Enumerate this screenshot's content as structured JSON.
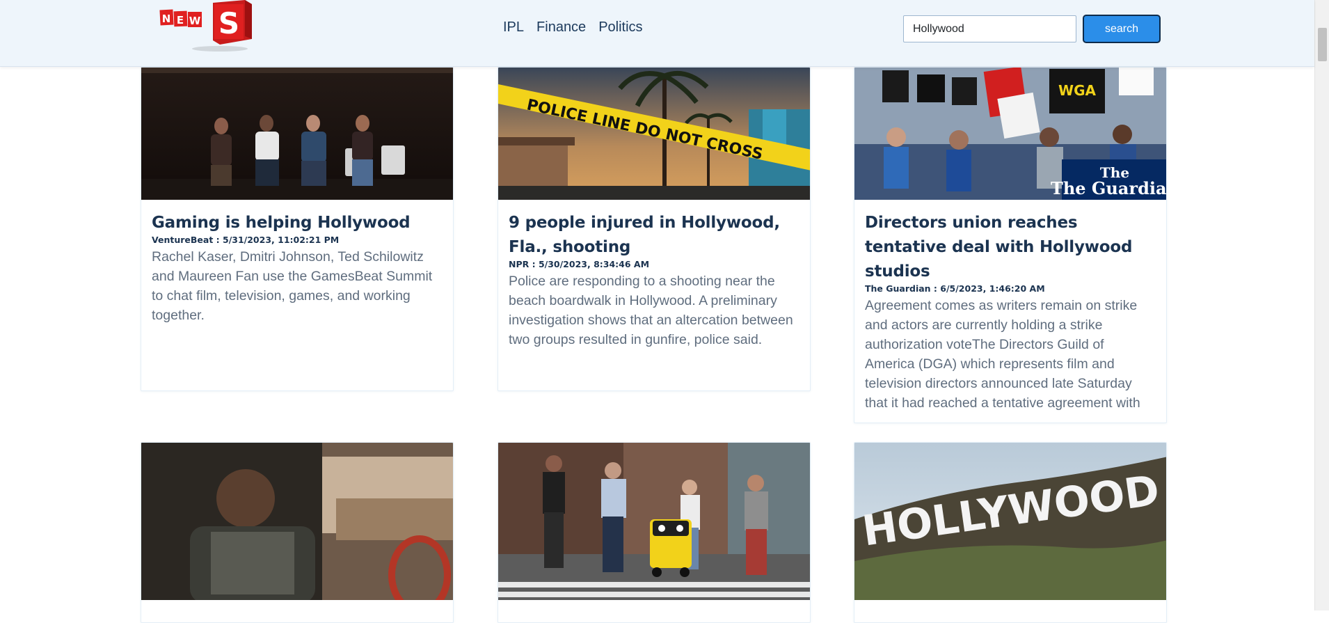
{
  "header": {
    "logo_text": "NEWS",
    "nav": [
      "IPL",
      "Finance",
      "Politics"
    ],
    "search_value": "Hollywood",
    "search_button": "search"
  },
  "colors": {
    "header_bg": "#eef5fb",
    "button": "#2b8ee9",
    "title": "#1b3350",
    "body_text": "#5f6d7e",
    "logo_red": "#e02020"
  },
  "articles": [
    {
      "title": "Gaming is helping Hollywood",
      "meta": "VentureBeat : 5/31/2023, 11:02:21 PM",
      "description": "Rachel Kaser, Dmitri Johnson, Ted Schilowitz and Maureen Fan use the GamesBeat Summit to chat film, television, games, and working together.",
      "image": "panel-discussion-photo"
    },
    {
      "title": "9 people injured in Hollywood, Fla., shooting",
      "meta": "NPR : 5/30/2023, 8:34:46 AM",
      "description": "Police are responding to a shooting near the beach boardwalk in Hollywood. A preliminary investigation shows that an altercation between two groups resulted in gunfire, police said.",
      "image": "police-line-photo",
      "image_text": "POLICE LINE DO NOT CROSS"
    },
    {
      "title": "Directors union reaches tentative deal with Hollywood studios",
      "meta": "The Guardian : 6/5/2023, 1:46:20 AM",
      "description": "Agreement comes as writers remain on strike and actors are currently holding a strike authorization voteThe Directors Guild of America (DGA) which represents film and television directors announced late Saturday that it had reached a tentative agreement with …",
      "image": "writers-strike-photo",
      "image_text": "The Guardian"
    },
    {
      "image": "actor-in-car-photo"
    },
    {
      "image": "delivery-robot-street-photo"
    },
    {
      "image": "hollywood-sign-photo",
      "image_text": "HOLLYWOOD"
    }
  ]
}
